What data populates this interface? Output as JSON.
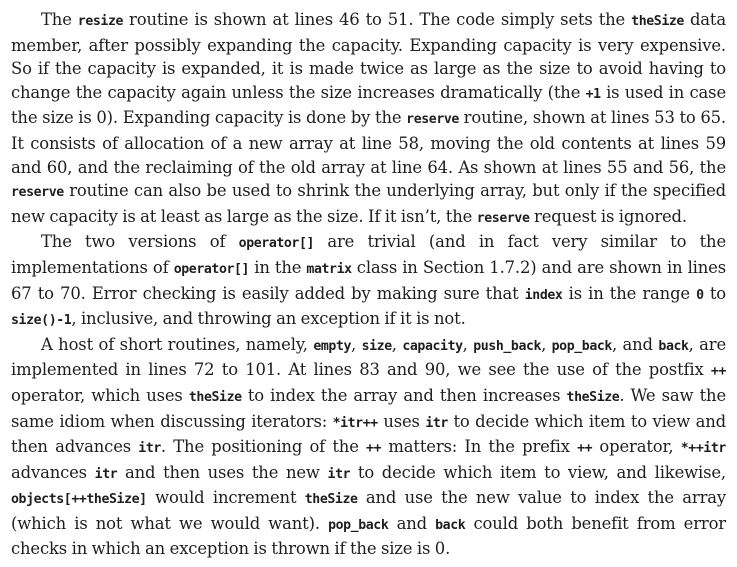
{
  "paragraphs": [
    [
      {
        "t": "The "
      },
      {
        "c": "resize"
      },
      {
        "t": " routine is shown at lines 46 to 51. The code simply sets the "
      },
      {
        "c": "theSize"
      },
      {
        "t": " data member, after possibly expanding the capacity. Expanding capacity is very expensive. So if the capacity is expanded, it is made twice as large as the size to avoid having to change the capacity again unless the size increases dramatically (the "
      },
      {
        "c": "+1"
      },
      {
        "t": " is used in case the size is 0). Expanding capacity is done by the "
      },
      {
        "c": "reserve"
      },
      {
        "t": " routine, shown at lines 53 to 65. It consists of allocation of a new array at line 58, moving the old contents at lines 59 and 60, and the reclaiming of the old array at line 64. As shown at lines 55 and 56, the "
      },
      {
        "c": "reserve"
      },
      {
        "t": " routine can also be used to shrink the underlying array, but only if the specified new capacity is at least as large as the size. If it isn’t, the "
      },
      {
        "c": "reserve"
      },
      {
        "t": " request is ignored."
      }
    ],
    [
      {
        "t": "The two versions of "
      },
      {
        "c": "operator[]"
      },
      {
        "t": " are trivial (and in fact very similar to the implementations of "
      },
      {
        "c": "operator[]"
      },
      {
        "t": " in the "
      },
      {
        "c": "matrix"
      },
      {
        "t": " class in Section 1.7.2) and are shown in lines 67 to 70. Error checking is easily added by making sure that "
      },
      {
        "c": "index"
      },
      {
        "t": " is in the range "
      },
      {
        "c": "0"
      },
      {
        "t": " to "
      },
      {
        "c": "size()-1"
      },
      {
        "t": ", inclusive, and throwing an exception if it is not."
      }
    ],
    [
      {
        "t": "A host of short routines, namely, "
      },
      {
        "c": "empty"
      },
      {
        "t": ", "
      },
      {
        "c": "size"
      },
      {
        "t": ", "
      },
      {
        "c": "capacity"
      },
      {
        "t": ", "
      },
      {
        "c": "push_back"
      },
      {
        "t": ", "
      },
      {
        "c": "pop_back"
      },
      {
        "t": ", and "
      },
      {
        "c": "back"
      },
      {
        "t": ", are implemented in lines 72 to 101. At lines 83 and 90, we see the use of the postfix "
      },
      {
        "c": "++"
      },
      {
        "t": " operator, which uses "
      },
      {
        "c": "theSize"
      },
      {
        "t": " to index the array and then increases "
      },
      {
        "c": "theSize"
      },
      {
        "t": ". We saw the same idiom when discussing iterators: "
      },
      {
        "c": "*itr++"
      },
      {
        "t": " uses "
      },
      {
        "c": "itr"
      },
      {
        "t": " to decide which item to view and then advances "
      },
      {
        "c": "itr"
      },
      {
        "t": ". The positioning of the "
      },
      {
        "c": "++"
      },
      {
        "t": " matters: In the prefix "
      },
      {
        "c": "++"
      },
      {
        "t": " operator, "
      },
      {
        "c": "*++itr"
      },
      {
        "t": " advances "
      },
      {
        "c": "itr"
      },
      {
        "t": " and then uses the new "
      },
      {
        "c": "itr"
      },
      {
        "t": " to decide which item to view, and likewise, "
      },
      {
        "c": "objects[++theSize]"
      },
      {
        "t": " would increment "
      },
      {
        "c": "theSize"
      },
      {
        "t": " and use the new value to index the array (which is not what we would want). "
      },
      {
        "c": "pop_back"
      },
      {
        "t": " and "
      },
      {
        "c": "back"
      },
      {
        "t": " could both benefit from error checks in which an exception is thrown if the size is 0."
      }
    ]
  ]
}
